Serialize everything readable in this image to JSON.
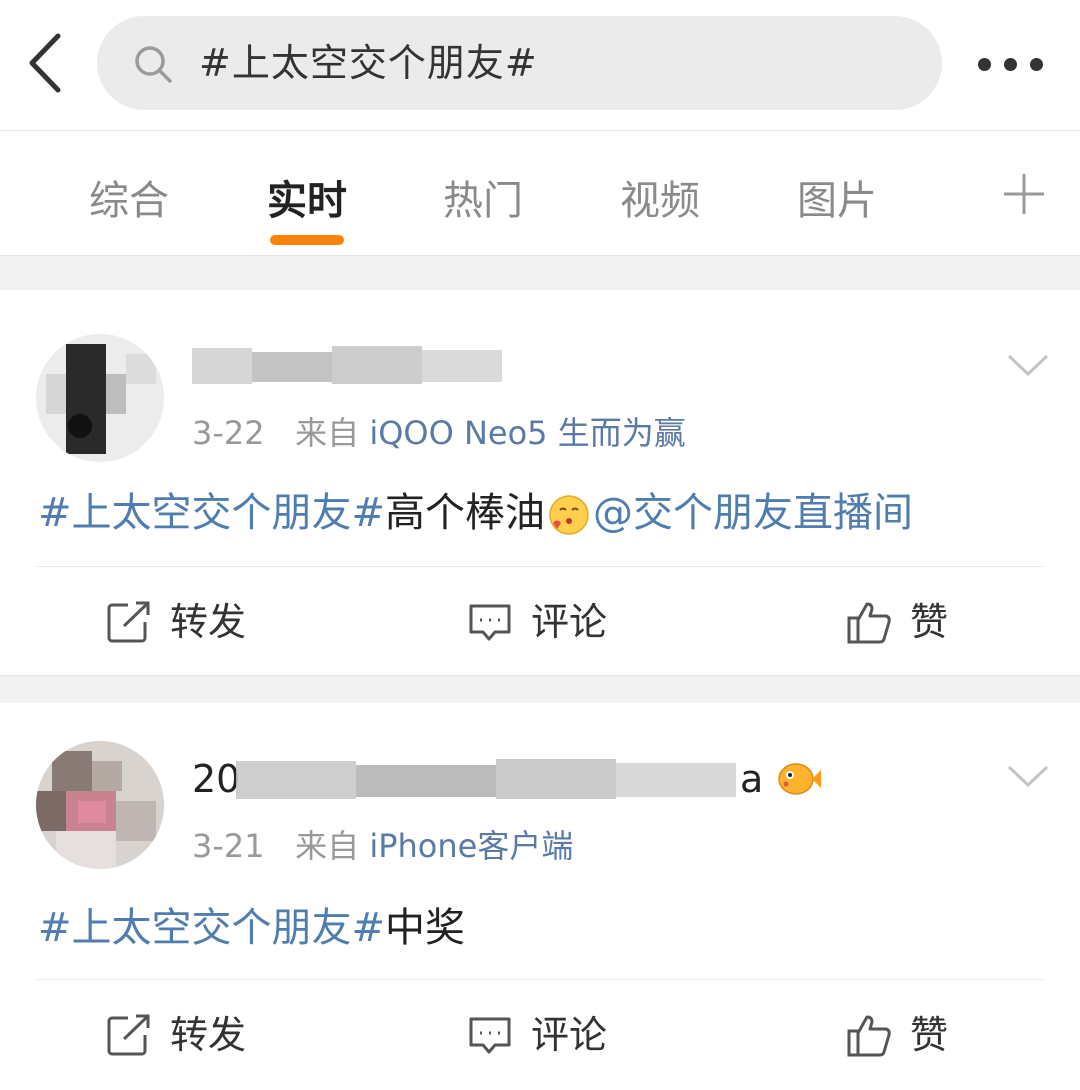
{
  "search": {
    "query": "#上太空交个朋友#"
  },
  "tabs": [
    {
      "label": "综合",
      "active": false
    },
    {
      "label": "实时",
      "active": true
    },
    {
      "label": "热门",
      "active": false
    },
    {
      "label": "视频",
      "active": false
    },
    {
      "label": "图片",
      "active": false
    }
  ],
  "colors": {
    "accent": "#ff8200",
    "link": "#507daf",
    "source": "#5b7aa6",
    "meta": "#999999"
  },
  "posts": [
    {
      "username": "",
      "date": "3-22",
      "source_prefix": "来自",
      "source": "iQOO Neo5 生而为赢",
      "hashtag": "#上太空交个朋友#",
      "text": "高个棒油",
      "mention": "@交个朋友直播间",
      "actions": {
        "repost": "转发",
        "comment": "评论",
        "like": "赞"
      }
    },
    {
      "username_prefix": "20",
      "username_suffix": "a",
      "date": "3-21",
      "source_prefix": "来自",
      "source": "iPhone客户端",
      "hashtag": "#上太空交个朋友#",
      "text": "中奖",
      "actions": {
        "repost": "转发",
        "comment": "评论",
        "like": "赞"
      }
    }
  ]
}
